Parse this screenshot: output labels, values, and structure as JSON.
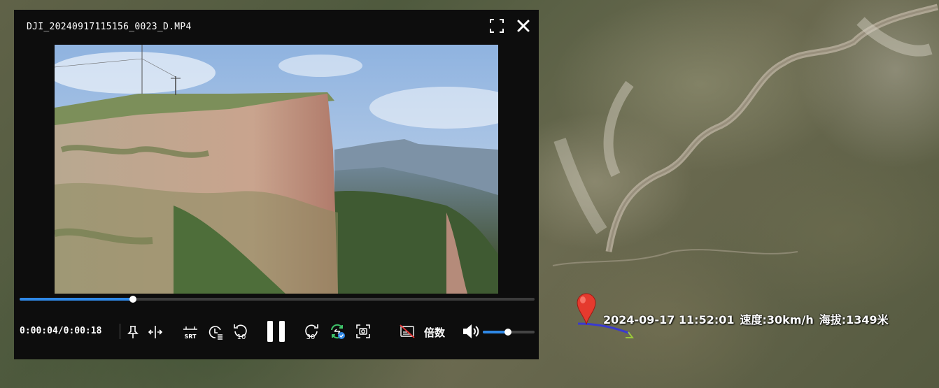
{
  "player": {
    "title": "DJI_20240917115156_0023_D.MP4",
    "time": {
      "current": "0:00:04",
      "total": "0:00:18",
      "display": "0:00:04/0:00:18"
    },
    "progress_fraction": 0.22,
    "volume_fraction": 0.48,
    "controls": {
      "srt_label": "SRT",
      "rewind_label": "10",
      "forward_label": "30",
      "speed_label": "倍数"
    },
    "icons": {
      "fullscreen": "fullscreen-icon",
      "close": "close-icon",
      "pin": "pin-icon",
      "split": "split-icon",
      "srt": "subtitle-icon",
      "timer": "timer-list-icon",
      "rewind": "rewind-icon",
      "pause": "pause-icon",
      "forward": "forward-icon",
      "sync": "sync-icon",
      "screenshot": "screenshot-icon",
      "hide-subtitle": "hide-subtitle-icon",
      "volume": "volume-icon"
    },
    "accent_color": "#2f88e6"
  },
  "map": {
    "telemetry": {
      "datetime": "2024-09-17 11:52:01",
      "speed": "速度:30km/h",
      "altitude": "海拔:1349米"
    },
    "marker_color": "#e53a2e",
    "path_color": "#3a3ad0"
  }
}
